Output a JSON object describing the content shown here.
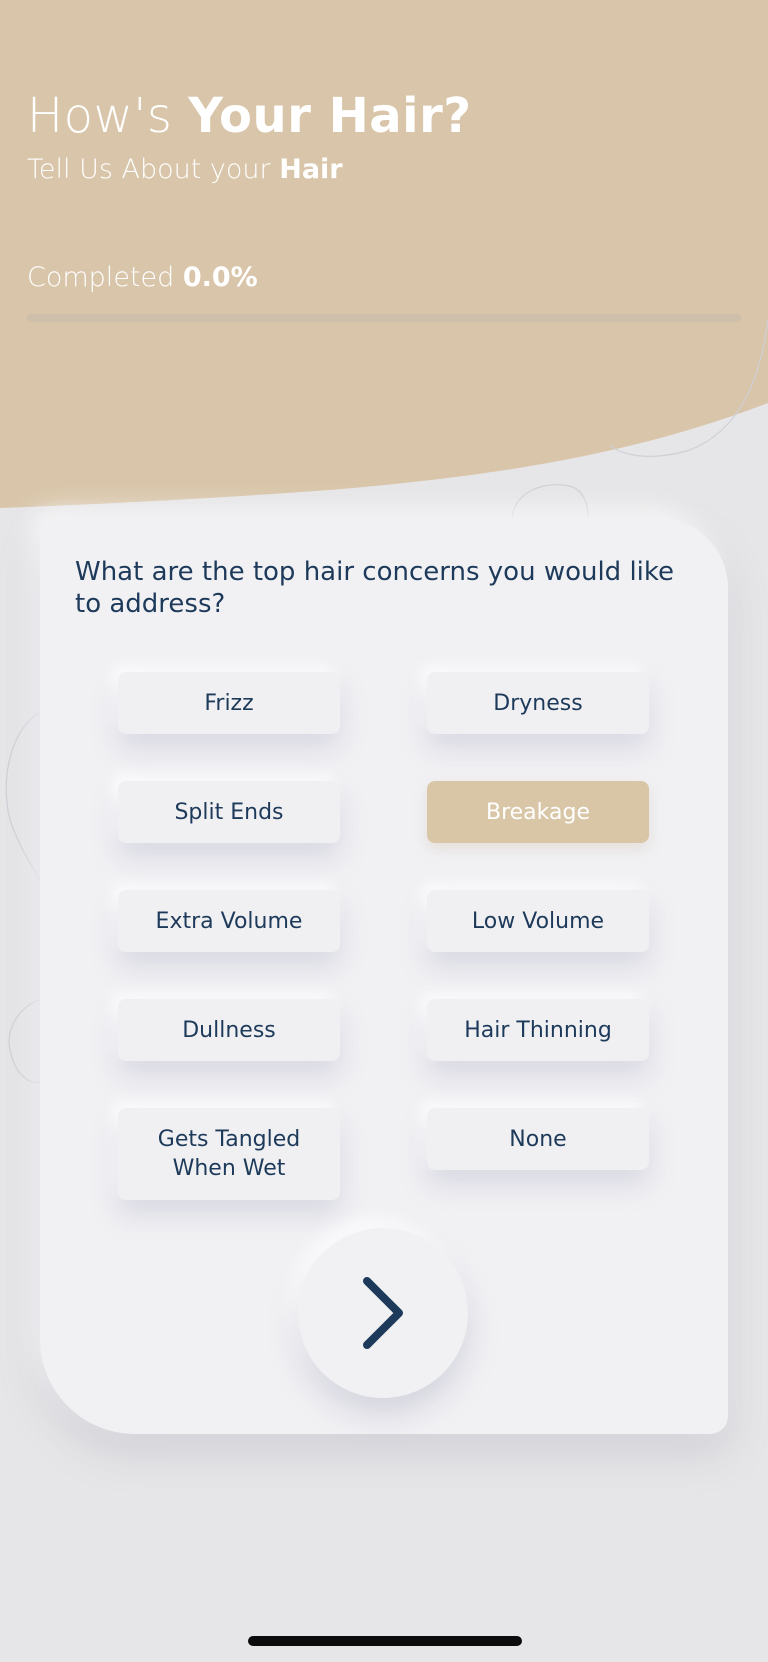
{
  "header": {
    "title_light": "How's ",
    "title_bold": "Your Hair?",
    "subtitle_light": "Tell Us About your ",
    "subtitle_bold": "Hair",
    "completed_label": "Completed ",
    "completed_value": "0.0%",
    "progress_fraction": 0.0
  },
  "question": "What are the top hair concerns you would like to address?",
  "options": [
    {
      "label": "Frizz",
      "selected": false
    },
    {
      "label": "Dryness",
      "selected": false
    },
    {
      "label": "Split Ends",
      "selected": false
    },
    {
      "label": "Breakage",
      "selected": true
    },
    {
      "label": "Extra Volume",
      "selected": false
    },
    {
      "label": "Low Volume",
      "selected": false
    },
    {
      "label": "Dullness",
      "selected": false
    },
    {
      "label": "Hair Thinning",
      "selected": false
    },
    {
      "label": "Gets Tangled When Wet",
      "selected": false
    },
    {
      "label": "None",
      "selected": false
    }
  ],
  "next_button": {
    "icon": "chevron-right-icon"
  },
  "colors": {
    "accent": "#d9c6a7",
    "text_dark": "#1e3a5a",
    "background": "#e6e6e8",
    "card": "#f1f1f4"
  }
}
